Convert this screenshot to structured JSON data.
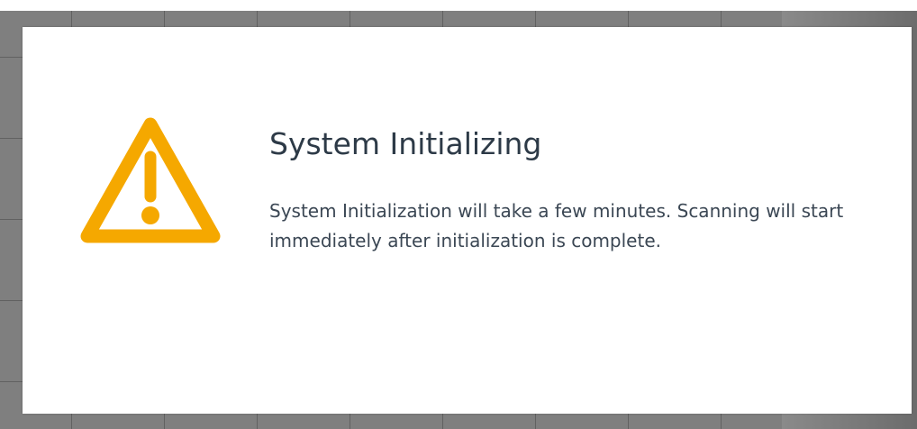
{
  "dialog": {
    "title": "System Initializing",
    "message": "System Initialization will take a few minutes. Scanning will start immediately after initialization is complete.",
    "icon": "warning-icon",
    "icon_color": "#F5A800"
  },
  "colors": {
    "backdrop": "#7f7f7f",
    "dialog_background": "#ffffff",
    "title_text": "#2d3a47",
    "body_text": "#3b4754"
  }
}
